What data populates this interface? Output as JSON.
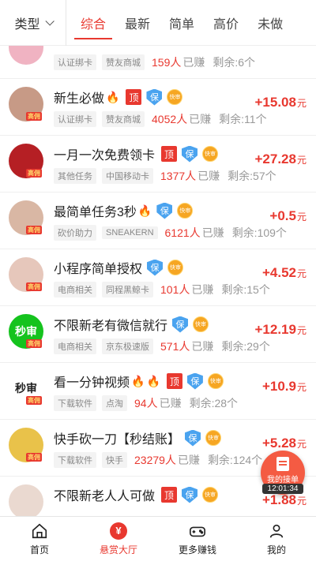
{
  "topbar": {
    "type_filter": "类型",
    "tabs": [
      "综合",
      "最新",
      "简单",
      "高价",
      "未做"
    ],
    "active_tab": 0
  },
  "tasks": [
    {
      "title": "",
      "avatar_color": "#f0b3c2",
      "avatar_tag": "",
      "chips": [
        "认证绑卡",
        "赞友商城"
      ],
      "earned": "159人",
      "remain": "剩余:6个",
      "price": "",
      "fire": 0,
      "ding": false,
      "bao": false,
      "kuai": false
    },
    {
      "title": "新生必做",
      "avatar_color": "#c79a86",
      "avatar_tag": "高佣",
      "chips": [
        "认证绑卡",
        "赞友商城"
      ],
      "earned": "4052人",
      "remain": "剩余:11个",
      "price": "+15.08",
      "fire": 1,
      "ding": true,
      "bao": true,
      "kuai": true
    },
    {
      "title": "一月一次免费领卡",
      "avatar_color": "#b51f24",
      "avatar_tag": "高佣",
      "chips": [
        "其他任务",
        "中国移动卡"
      ],
      "earned": "1377人",
      "remain": "剩余:57个",
      "price": "+27.28",
      "fire": 0,
      "ding": true,
      "bao": true,
      "kuai": true
    },
    {
      "title": "最简单任务3秒",
      "avatar_color": "#d9b7a4",
      "avatar_tag": "高佣",
      "chips": [
        "砍价助力",
        "SNEAKERN"
      ],
      "earned": "6121人",
      "remain": "剩余:109个",
      "price": "+0.5",
      "fire": 1,
      "ding": false,
      "bao": true,
      "kuai": true
    },
    {
      "title": "小程序简单授权",
      "avatar_color": "#e6c7bb",
      "avatar_tag": "高佣",
      "chips": [
        "电商相关",
        "同程黑鲸卡"
      ],
      "earned": "101人",
      "remain": "剩余:15个",
      "price": "+4.52",
      "fire": 0,
      "ding": false,
      "bao": true,
      "kuai": true
    },
    {
      "title": "不限新老有微信就行",
      "avatar_color": "#15c31e",
      "avatar_tag": "高佣",
      "avatar_text": "秒审",
      "chips": [
        "电商相关",
        "京东极速版"
      ],
      "earned": "571人",
      "remain": "剩余:29个",
      "price": "+12.19",
      "fire": 0,
      "ding": false,
      "bao": true,
      "kuai": true
    },
    {
      "title": "看一分钟视频",
      "avatar_color": "#ffffff",
      "avatar_tag": "高佣",
      "avatar_text": "秒审",
      "chips": [
        "下载软件",
        "点淘"
      ],
      "earned": "94人",
      "remain": "剩余:28个",
      "price": "+10.9",
      "fire": 2,
      "ding": true,
      "bao": true,
      "kuai": true
    },
    {
      "title": "快手砍一刀【秒结账】",
      "avatar_color": "#e9c24a",
      "avatar_tag": "高佣",
      "chips": [
        "下载软件",
        "快手"
      ],
      "earned": "23279人",
      "remain": "剩余:124个",
      "price": "+5.28",
      "fire": 0,
      "ding": false,
      "bao": true,
      "kuai": true
    },
    {
      "title": "不限新老人人可做",
      "avatar_color": "#ead9d0",
      "avatar_tag": "",
      "chips": [
        "",
        ""
      ],
      "earned": "",
      "remain": "",
      "price": "+1.88",
      "fire": 0,
      "ding": true,
      "bao": true,
      "kuai": true
    }
  ],
  "labels": {
    "earned_suffix": "已赚",
    "unit": "元",
    "ding": "顶",
    "bao": "保",
    "kuai": "快审"
  },
  "float_button": {
    "label": "我的接单",
    "timer": "12:01:34"
  },
  "bottom_nav": [
    {
      "label": "首页",
      "icon": "home-icon"
    },
    {
      "label": "悬赏大厅",
      "icon": "yen-icon",
      "active": true
    },
    {
      "label": "更多赚钱",
      "icon": "gamepad-icon"
    },
    {
      "label": "我的",
      "icon": "user-icon"
    }
  ],
  "colors": {
    "accent": "#e8382f",
    "shield": "#4aa3ef",
    "quick": "#f6a623"
  }
}
